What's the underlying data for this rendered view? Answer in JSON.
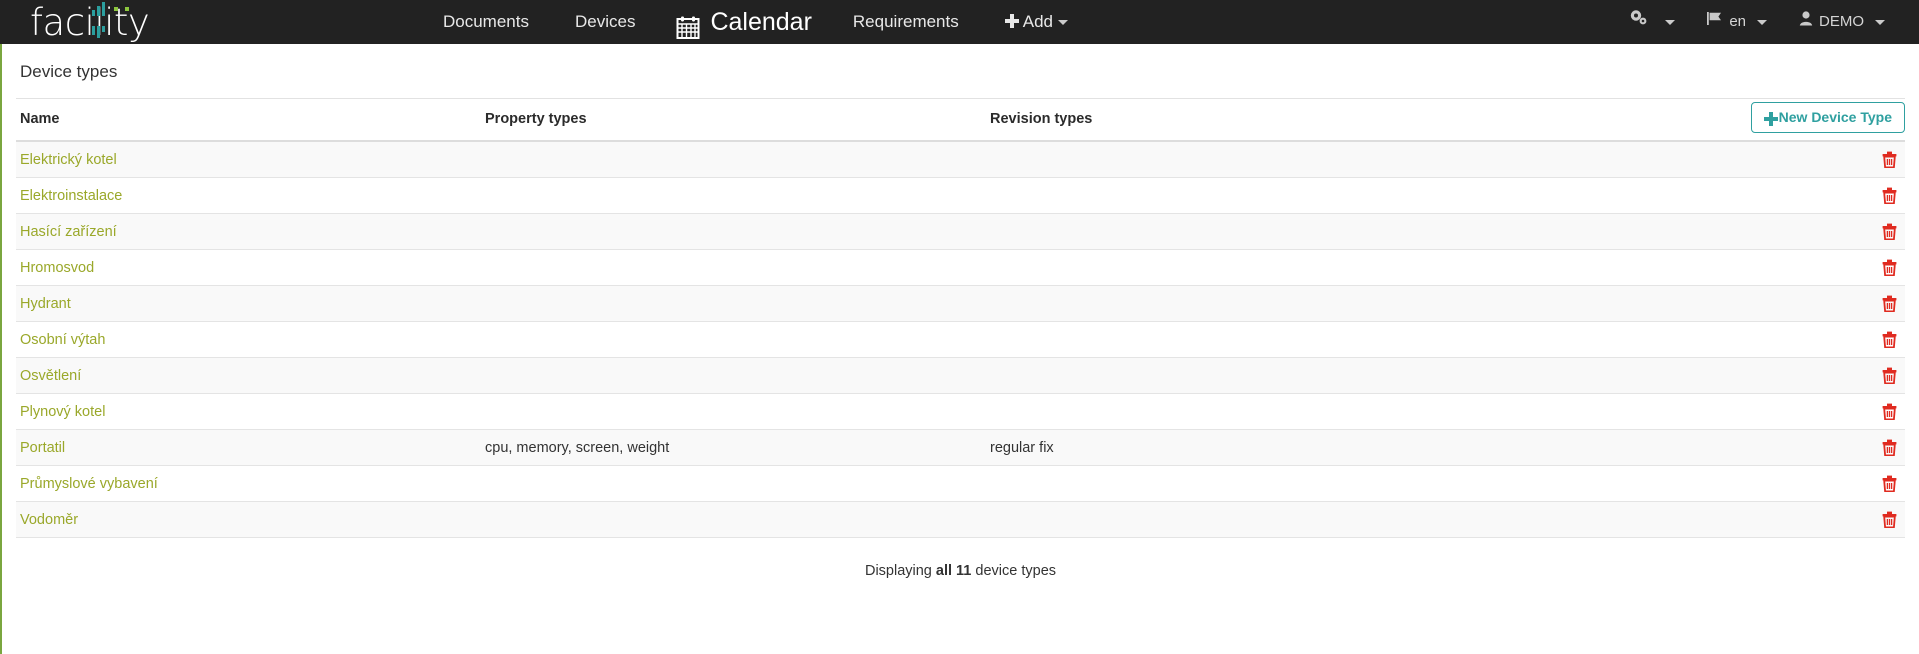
{
  "navbar": {
    "brand": "facility",
    "items": [
      {
        "label": "Documents",
        "name": "nav-documents",
        "style": "normal"
      },
      {
        "label": "Devices",
        "name": "nav-devices",
        "style": "normal"
      },
      {
        "label": "Calendar",
        "name": "nav-calendar",
        "style": "big",
        "icon": "calendar-icon"
      },
      {
        "label": "Requirements",
        "name": "nav-requirements",
        "style": "normal"
      },
      {
        "label": "Add",
        "name": "nav-add",
        "style": "dropdown",
        "icon": "plus-icon"
      }
    ],
    "right": [
      {
        "label": "",
        "name": "settings-menu",
        "icon": "gears-icon"
      },
      {
        "label": "en",
        "name": "language-menu",
        "icon": "flag-icon"
      },
      {
        "label": "DEMO",
        "name": "user-menu",
        "icon": "user-icon"
      }
    ]
  },
  "page": {
    "title": "Device types",
    "new_button": "New Device Type",
    "footer_prefix": "Displaying ",
    "footer_strong": "all 11",
    "footer_suffix": " device types"
  },
  "table": {
    "headers": [
      "Name",
      "Property types",
      "Revision types"
    ],
    "rows": [
      {
        "name": "Elektrický kotel",
        "property_types": "",
        "revision_types": ""
      },
      {
        "name": "Elektroinstalace",
        "property_types": "",
        "revision_types": ""
      },
      {
        "name": "Hasící zařízení",
        "property_types": "",
        "revision_types": ""
      },
      {
        "name": "Hromosvod",
        "property_types": "",
        "revision_types": ""
      },
      {
        "name": "Hydrant",
        "property_types": "",
        "revision_types": ""
      },
      {
        "name": "Osobní výtah",
        "property_types": "",
        "revision_types": ""
      },
      {
        "name": "Osvětlení",
        "property_types": "",
        "revision_types": ""
      },
      {
        "name": "Plynový kotel",
        "property_types": "",
        "revision_types": ""
      },
      {
        "name": "Portatil",
        "property_types": "cpu, memory, screen, weight",
        "revision_types": "regular fix"
      },
      {
        "name": "Průmyslové vybavení",
        "property_types": "",
        "revision_types": ""
      },
      {
        "name": "Vodoměr",
        "property_types": "",
        "revision_types": ""
      }
    ],
    "delete_icon": "trash-icon"
  },
  "colors": {
    "navbar_bg": "#222222",
    "link": "#9aa82a",
    "accent_teal": "#2fa0a0",
    "left_border": "#7aa63f",
    "delete_red": "#e02b20"
  }
}
